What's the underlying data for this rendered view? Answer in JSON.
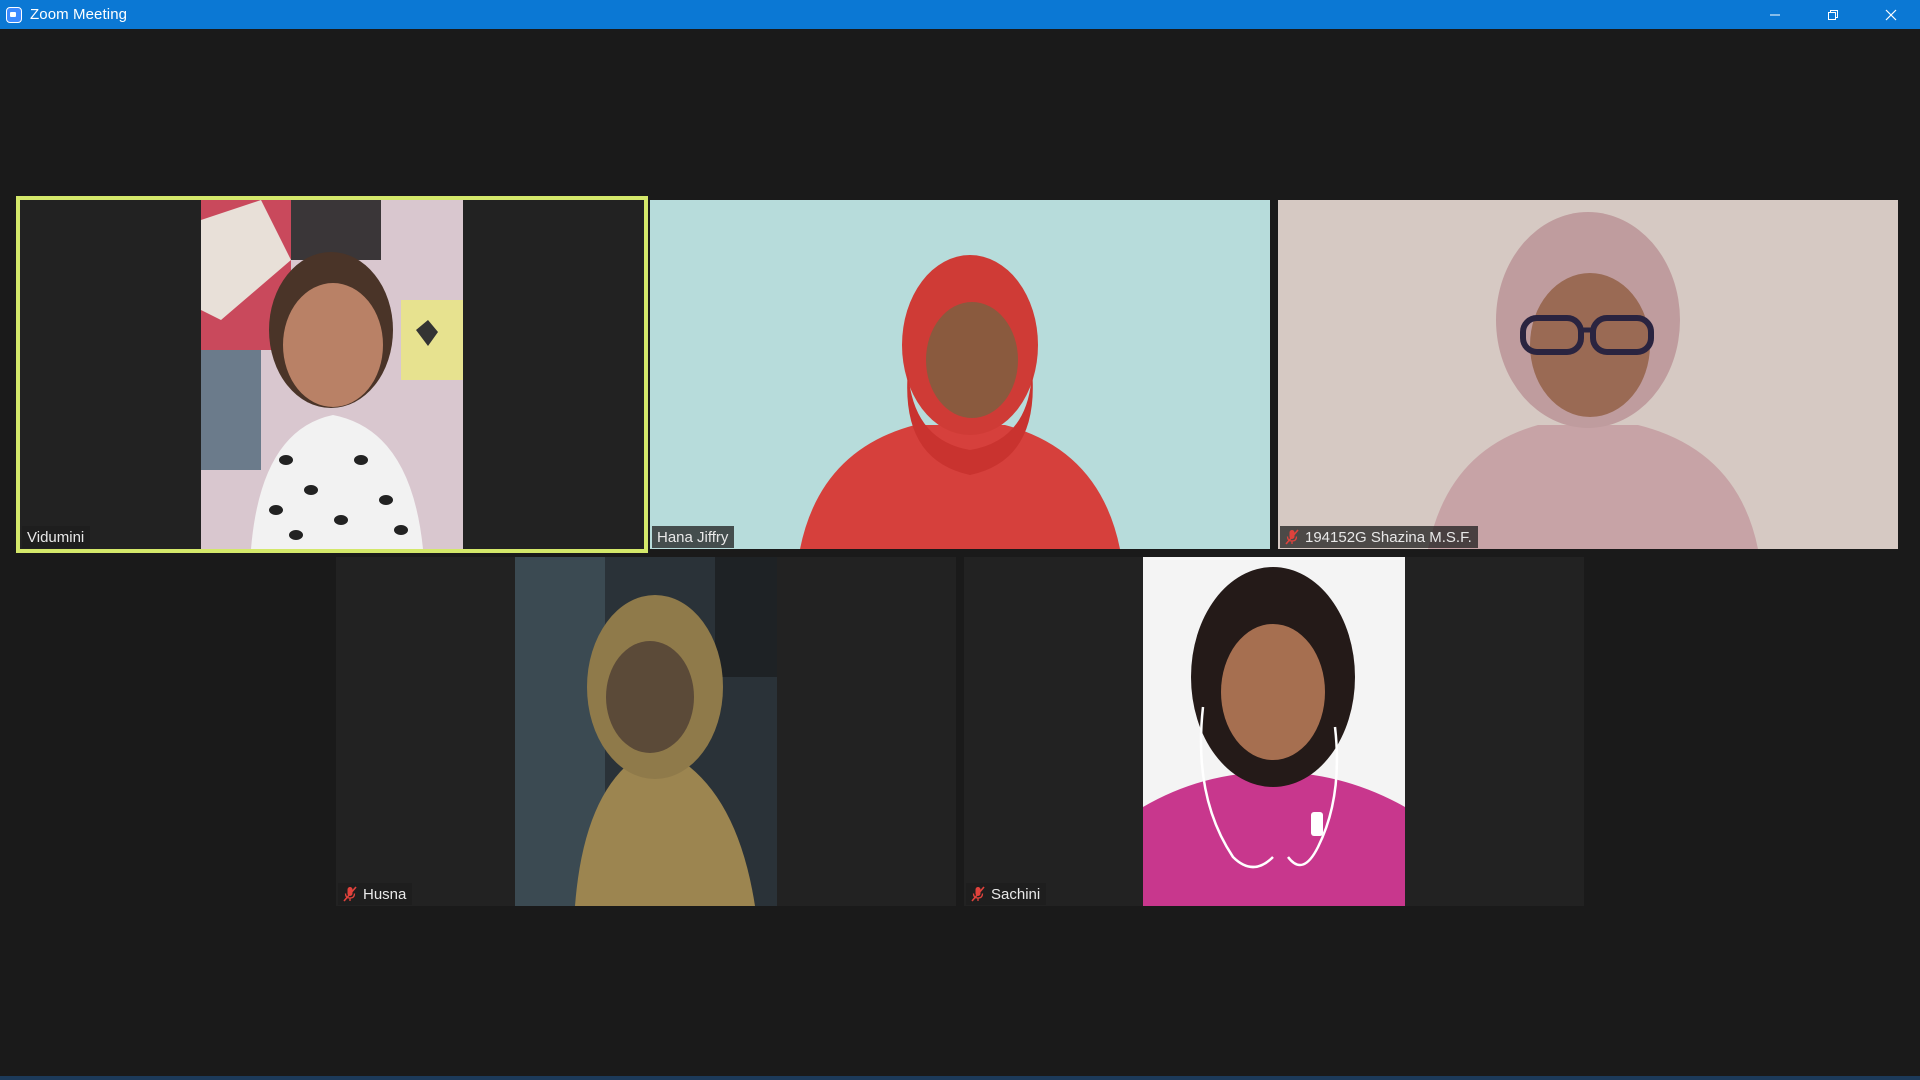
{
  "window": {
    "title": "Zoom Meeting",
    "controls": {
      "minimize": "minimize-icon",
      "restore": "restore-icon",
      "close": "close-icon"
    }
  },
  "colors": {
    "titlebar": "#0b78d4",
    "background": "#1a1a1a",
    "active_speaker_border": "#d4e86a",
    "muted_icon": "#e0423c"
  },
  "participants": [
    {
      "name": "Vidumini",
      "muted": false,
      "active_speaker": true
    },
    {
      "name": "Hana Jiffry",
      "muted": false,
      "active_speaker": false
    },
    {
      "name": "194152G Shazina M.S.F.",
      "muted": true,
      "active_speaker": false
    },
    {
      "name": "Husna",
      "muted": true,
      "active_speaker": false
    },
    {
      "name": "Sachini",
      "muted": true,
      "active_speaker": false
    }
  ]
}
